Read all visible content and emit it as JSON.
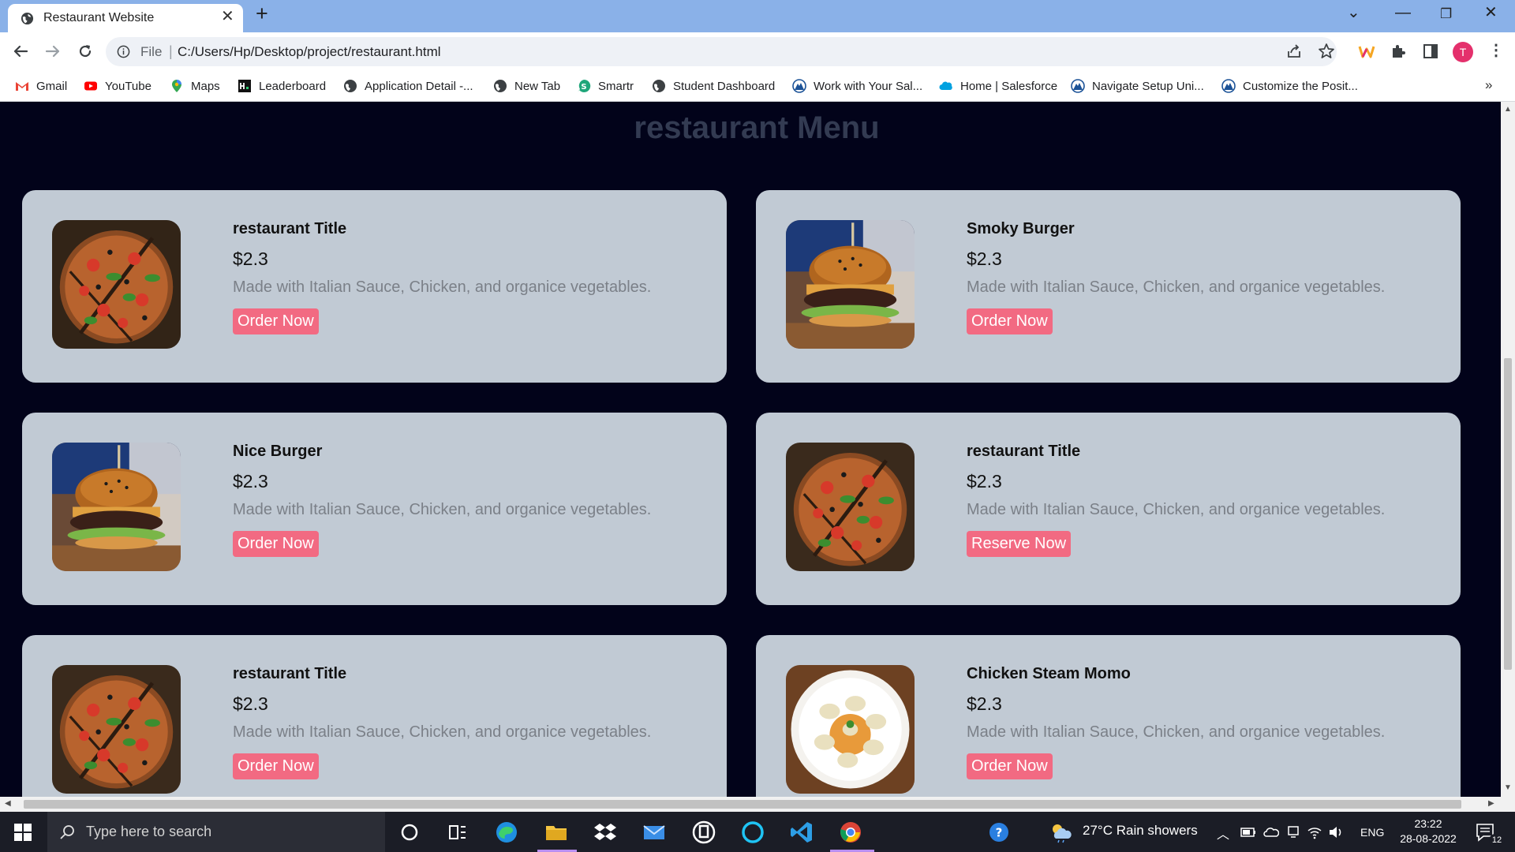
{
  "browser": {
    "tab_title": "Restaurant Website",
    "scheme_label": "File",
    "url": "C:/Users/Hp/Desktop/project/restaurant.html",
    "profile_initial": "T",
    "bookmarks": [
      {
        "label": "Gmail",
        "icon": "gmail-icon"
      },
      {
        "label": "YouTube",
        "icon": "youtube-icon"
      },
      {
        "label": "Maps",
        "icon": "maps-icon"
      },
      {
        "label": "Leaderboard",
        "icon": "leaderboard-icon"
      },
      {
        "label": "Application Detail -...",
        "icon": "globe-icon"
      },
      {
        "label": "New Tab",
        "icon": "globe-icon"
      },
      {
        "label": "Smartr",
        "icon": "smartr-icon"
      },
      {
        "label": "Student Dashboard",
        "icon": "globe-icon"
      },
      {
        "label": "Work with Your Sal...",
        "icon": "trailhead-icon"
      },
      {
        "label": "Home | Salesforce",
        "icon": "salesforce-cloud-icon"
      },
      {
        "label": "Navigate Setup Uni...",
        "icon": "trailhead-icon"
      },
      {
        "label": "Customize the Posit...",
        "icon": "trailhead-icon"
      }
    ]
  },
  "page": {
    "title": "restaurant Menu",
    "menu_items": [
      {
        "title": "restaurant Title",
        "price": "$2.3",
        "description": "Made with Italian Sauce, Chicken, and organice vegetables.",
        "button": "Order Now",
        "image": "pizza"
      },
      {
        "title": "Smoky Burger",
        "price": "$2.3",
        "description": "Made with Italian Sauce, Chicken, and organice vegetables.",
        "button": "Order Now",
        "image": "burger"
      },
      {
        "title": "Nice Burger",
        "price": "$2.3",
        "description": "Made with Italian Sauce, Chicken, and organice vegetables.",
        "button": "Order Now",
        "image": "burger"
      },
      {
        "title": "restaurant Title",
        "price": "$2.3",
        "description": "Made with Italian Sauce, Chicken, and organice vegetables.",
        "button": "Reserve Now",
        "image": "pizza"
      },
      {
        "title": "restaurant Title",
        "price": "$2.3",
        "description": "Made with Italian Sauce, Chicken, and organice vegetables.",
        "button": "Order Now",
        "image": "pizza"
      },
      {
        "title": "Chicken Steam Momo",
        "price": "$2.3",
        "description": "Made with Italian Sauce, Chicken, and organice vegetables.",
        "button": "Order Now",
        "image": "momo"
      }
    ]
  },
  "taskbar": {
    "search_placeholder": "Type here to search",
    "weather": "27°C  Rain showers",
    "language": "ENG",
    "time": "23:22",
    "date": "28-08-2022",
    "notification_count": "12"
  },
  "colors": {
    "page_background": "#02031a",
    "card_background": "#c1cad4",
    "button": "#f26a82",
    "title_text": "#333b52"
  }
}
